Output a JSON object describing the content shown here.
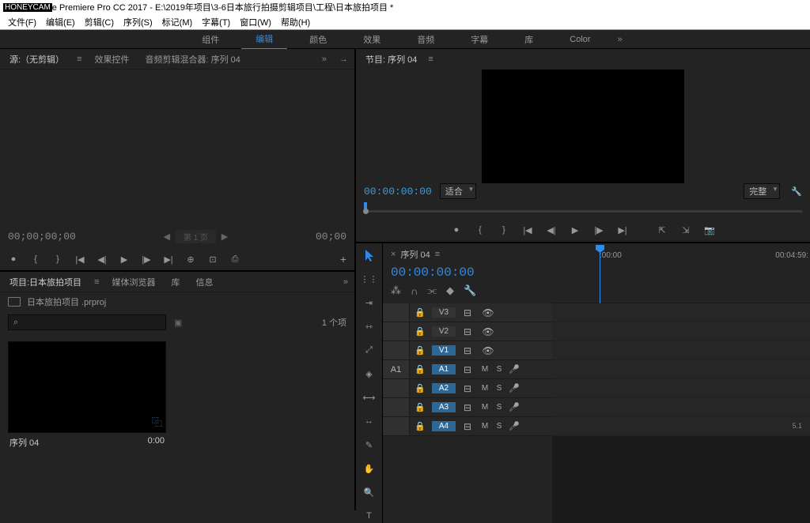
{
  "title_prefix": "HONEYCAM",
  "title_rest": "e Premiere Pro CC 2017 - E:\\2019年项目\\3-6日本旅行拍摄剪辑项目\\工程\\日本旅拍项目 *",
  "menu": [
    "文件(F)",
    "编辑(E)",
    "剪辑(C)",
    "序列(S)",
    "标记(M)",
    "字幕(T)",
    "窗口(W)",
    "帮助(H)"
  ],
  "workspaces": {
    "items": [
      "组件",
      "编辑",
      "颜色",
      "效果",
      "音频",
      "字幕",
      "库",
      "Color"
    ],
    "active_index": 1
  },
  "source_panel": {
    "tabs": [
      "源:（无剪辑）",
      "效果控件",
      "音频剪辑混合器: 序列 04"
    ],
    "active_tab_index": 0,
    "tc_left": "00;00;00;00",
    "page": "第 1 页",
    "tc_right": "00;00"
  },
  "program_panel": {
    "tab": "节目: 序列 04",
    "tc_left": "00:00:00:00",
    "fit": "适合",
    "res": "完整"
  },
  "project_panel": {
    "tabs": [
      "项目:日本旅拍项目",
      "媒体浏览器",
      "库",
      "信息"
    ],
    "active_tab_index": 0,
    "bin": "日本旅拍项目 .prproj",
    "search_placeholder": "",
    "count": "1 个项",
    "clip": {
      "name": "序列 04",
      "dur": "0:00"
    }
  },
  "timeline": {
    "sequence_tab": "序列 04",
    "tc": "00:00:00:00",
    "ruler": {
      "left_label": ":00:00",
      "right_label": "00:04:59:"
    },
    "video_tracks": [
      {
        "name": "V3"
      },
      {
        "name": "V2"
      },
      {
        "name": "V1",
        "targeted": true
      }
    ],
    "audio_tracks": [
      {
        "src": "A1",
        "name": "A1",
        "targeted": true
      },
      {
        "src": "",
        "name": "A2",
        "targeted": true
      },
      {
        "src": "",
        "name": "A3",
        "targeted": true
      },
      {
        "src": "",
        "name": "A4",
        "targeted": true
      }
    ],
    "label51": "5.1"
  }
}
